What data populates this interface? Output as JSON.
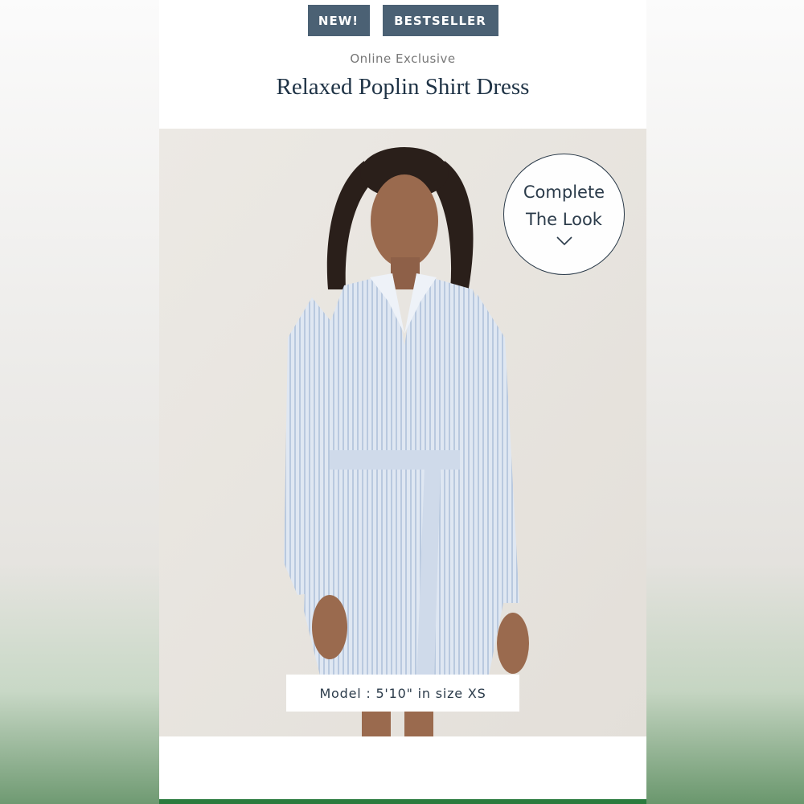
{
  "badges": {
    "new": "NEW!",
    "bestseller": "BESTSELLER"
  },
  "product": {
    "tag": "Online Exclusive",
    "title": "Relaxed Poplin Shirt Dress"
  },
  "complete_look": {
    "line1": "Complete",
    "line2": "The Look",
    "icon": "chevron-down-icon"
  },
  "model_info": "Model : 5'10\" in size XS",
  "colors": {
    "badge_bg": "#4b6174",
    "title": "#1f3346",
    "dress": "#c9d6e8",
    "accent_bar": "#2a7b3e"
  }
}
